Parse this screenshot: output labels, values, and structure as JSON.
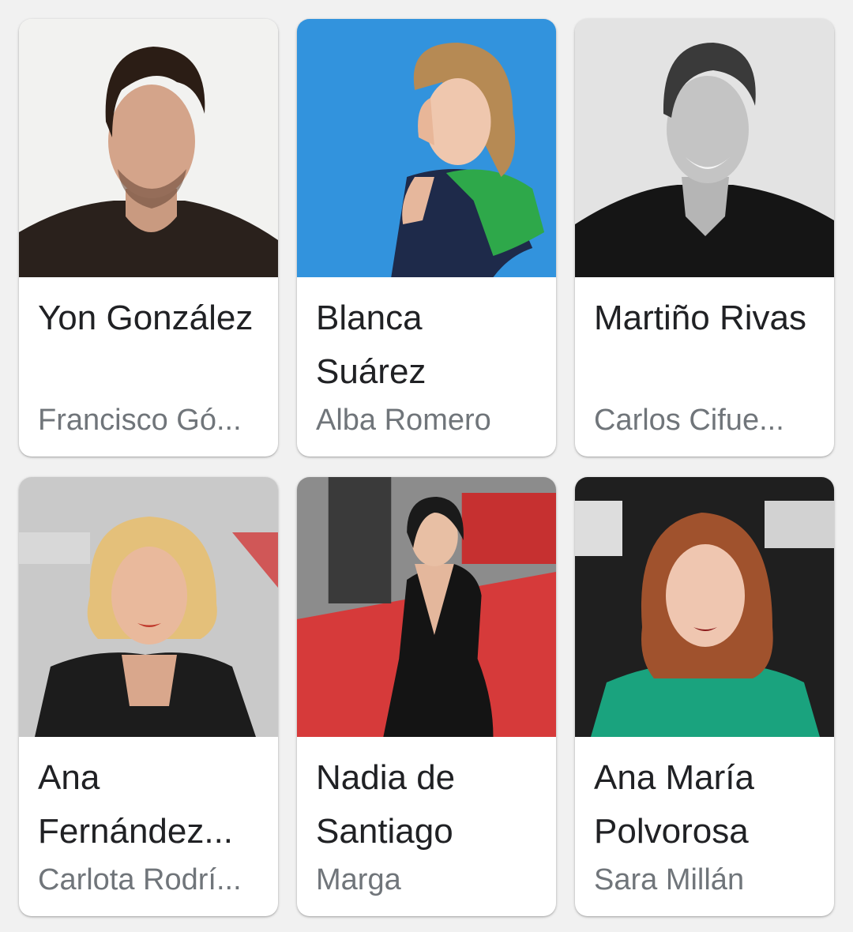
{
  "cast": [
    {
      "name": "Yon González",
      "role": "Francisco Gó..."
    },
    {
      "name": "Blanca Suárez",
      "role": "Alba Romero"
    },
    {
      "name": "Martiño Rivas",
      "role": "Carlos Cifue..."
    },
    {
      "name": "Ana Fernández...",
      "role": "Carlota Rodrí..."
    },
    {
      "name": "Nadia de Santiago",
      "role": "Marga"
    },
    {
      "name": "Ana María Polvorosa",
      "role": "Sara Millán"
    }
  ],
  "photos": [
    {
      "icon": "actor-portrait-photo",
      "background": "#f2f2f0",
      "accent": "#2a211c"
    },
    {
      "icon": "actress-red-carpet-photo",
      "background": "#2f8fd9",
      "accent": "#2ea84a"
    },
    {
      "icon": "actor-bw-portrait-photo",
      "background": "#dcdcdc",
      "accent": "#151515"
    },
    {
      "icon": "actress-event-photo",
      "background": "#c9c9c9",
      "accent": "#1c1c1c"
    },
    {
      "icon": "actress-red-carpet-photo",
      "background": "#d63a3a",
      "accent": "#141414"
    },
    {
      "icon": "actress-premiere-photo",
      "background": "#1f1f1f",
      "accent": "#1aa37e"
    }
  ]
}
